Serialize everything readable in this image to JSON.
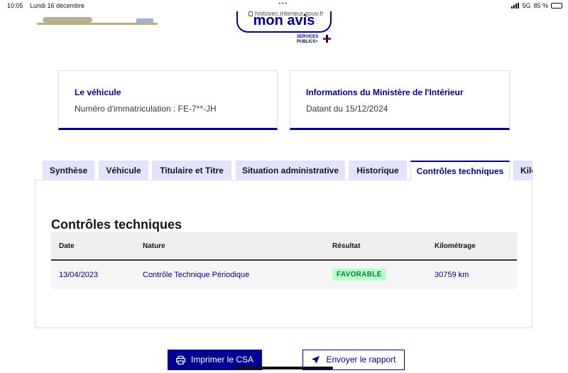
{
  "status_bar": {
    "time": "10:05",
    "date": "Lundi 16 décembre",
    "url": "histovec.interieur.gouv.fr",
    "network": "5G",
    "battery": "85 %",
    "battery_level": 0.85
  },
  "header": {
    "mon_avis_label": "mon avis",
    "services_line1": "SERVICES",
    "services_line2": "PUBLICS+"
  },
  "cards": {
    "vehicle": {
      "title": "Le véhicule",
      "text": "Numéro d'immatriculation : FE-7**-JH"
    },
    "ministry": {
      "title": "Informations du Ministère de l'Intérieur",
      "text": "Datant du 15/12/2024"
    }
  },
  "tabs": [
    {
      "label": "Synthèse",
      "active": false
    },
    {
      "label": "Véhicule",
      "active": false
    },
    {
      "label": "Titulaire et Titre",
      "active": false
    },
    {
      "label": "Situation administrative",
      "active": false
    },
    {
      "label": "Historique",
      "active": false
    },
    {
      "label": "Contrôles techniques",
      "active": true
    },
    {
      "label": "Kilo",
      "active": false
    }
  ],
  "section": {
    "title": "Contrôles techniques",
    "columns": [
      "Date",
      "Nature",
      "Résultat",
      "Kilométrage"
    ],
    "rows": [
      {
        "date": "13/04/2023",
        "nature": "Contrôle Technique Périodique",
        "result": "FAVORABLE",
        "mileage": "30759 km"
      }
    ]
  },
  "buttons": {
    "print_label": "Imprimer le CSA",
    "send_label": "Envoyer le rapport"
  },
  "colors": {
    "primary": "#000091",
    "tab_inactive": "#e3e3fd",
    "badge_bg": "#b8fec9",
    "badge_text": "#18753c"
  }
}
